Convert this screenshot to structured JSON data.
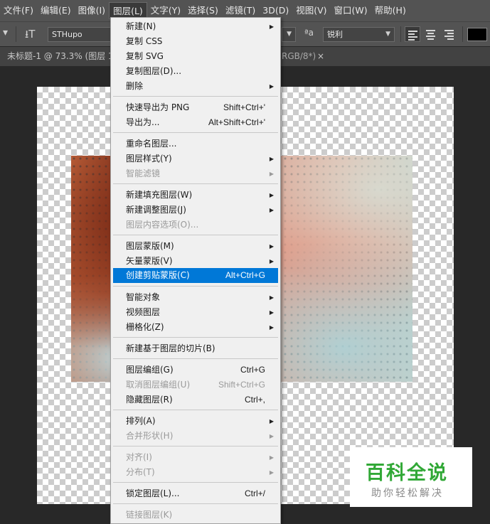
{
  "menubar": {
    "items": [
      {
        "label": "文件(F)"
      },
      {
        "label": "编辑(E)"
      },
      {
        "label": "图像(I)"
      },
      {
        "label": "图层(L)"
      },
      {
        "label": "文字(Y)"
      },
      {
        "label": "选择(S)"
      },
      {
        "label": "滤镜(T)"
      },
      {
        "label": "3D(D)"
      },
      {
        "label": "视图(V)"
      },
      {
        "label": "窗口(W)"
      },
      {
        "label": "帮助(H)"
      }
    ]
  },
  "options": {
    "font_family": "STHupo",
    "aa_label": "ªa",
    "antialias": "锐利",
    "text_color": "#000000"
  },
  "tabs": {
    "doc_title": "未标题-1 @ 73.3% (图层 1",
    "doc_title_tail": "RGB/8*)",
    "close": "×"
  },
  "layer_menu": {
    "items": [
      {
        "label": "新建(N)",
        "submenu": true
      },
      {
        "label": "复制 CSS"
      },
      {
        "label": "复制 SVG"
      },
      {
        "label": "复制图层(D)..."
      },
      {
        "label": "删除",
        "submenu": true
      },
      {
        "label": "快速导出为 PNG",
        "shortcut": "Shift+Ctrl+'"
      },
      {
        "label": "导出为...",
        "shortcut": "Alt+Shift+Ctrl+'"
      },
      {
        "label": "重命名图层..."
      },
      {
        "label": "图层样式(Y)",
        "submenu": true
      },
      {
        "label": "智能滤镜",
        "submenu": true,
        "disabled": true
      },
      {
        "label": "新建填充图层(W)",
        "submenu": true
      },
      {
        "label": "新建调整图层(J)",
        "submenu": true
      },
      {
        "label": "图层内容选项(O)...",
        "disabled": true
      },
      {
        "label": "图层蒙版(M)",
        "submenu": true
      },
      {
        "label": "矢量蒙版(V)",
        "submenu": true
      },
      {
        "label": "创建剪贴蒙版(C)",
        "shortcut": "Alt+Ctrl+G",
        "highlighted": true
      },
      {
        "label": "智能对象",
        "submenu": true
      },
      {
        "label": "视频图层",
        "submenu": true
      },
      {
        "label": "栅格化(Z)",
        "submenu": true
      },
      {
        "label": "新建基于图层的切片(B)"
      },
      {
        "label": "图层编组(G)",
        "shortcut": "Ctrl+G"
      },
      {
        "label": "取消图层编组(U)",
        "shortcut": "Shift+Ctrl+G",
        "disabled": true
      },
      {
        "label": "隐藏图层(R)",
        "shortcut": "Ctrl+,"
      },
      {
        "label": "排列(A)",
        "submenu": true
      },
      {
        "label": "合并形状(H)",
        "submenu": true,
        "disabled": true
      },
      {
        "label": "对齐(I)",
        "submenu": true,
        "disabled": true
      },
      {
        "label": "分布(T)",
        "submenu": true,
        "disabled": true
      },
      {
        "label": "锁定图层(L)...",
        "shortcut": "Ctrl+/"
      },
      {
        "label": "链接图层(K)",
        "disabled": true
      }
    ]
  },
  "watermark": {
    "title": "百科全说",
    "subtitle": "助你轻松解决",
    "color": "#31a836"
  },
  "colors": {
    "menu_highlight": "#0078d7",
    "chrome": "#535353"
  }
}
